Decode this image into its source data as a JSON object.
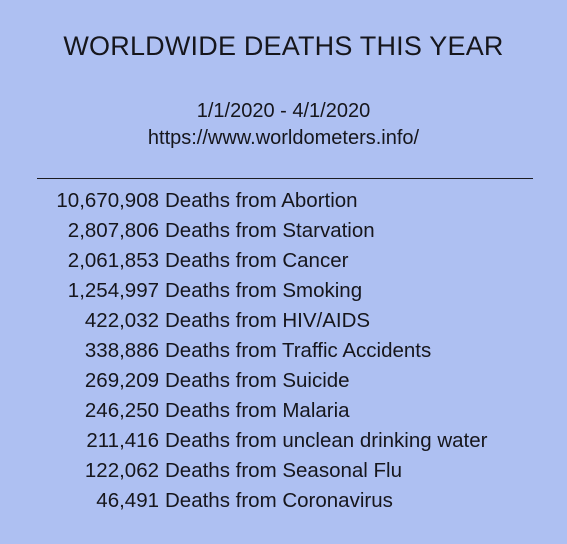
{
  "header": {
    "title": "WORLDWIDE DEATHS THIS YEAR",
    "date_range": "1/1/2020 - 4/1/2020",
    "source_url": "https://www.worldometers.info/"
  },
  "rows": [
    {
      "count": "10,670,908",
      "label": "Deaths from Abortion"
    },
    {
      "count": "2,807,806",
      "label": "Deaths from Starvation"
    },
    {
      "count": "2,061,853",
      "label": "Deaths from Cancer"
    },
    {
      "count": "1,254,997",
      "label": "Deaths from Smoking"
    },
    {
      "count": "422,032",
      "label": "Deaths from HIV/AIDS"
    },
    {
      "count": "338,886",
      "label": "Deaths from Traffic Accidents"
    },
    {
      "count": "269,209",
      "label": "Deaths from Suicide"
    },
    {
      "count": "246,250",
      "label": "Deaths from Malaria"
    },
    {
      "count": "211,416",
      "label": "Deaths from unclean drinking water"
    },
    {
      "count": "122,062",
      "label": "Deaths from Seasonal Flu"
    },
    {
      "count": "46,491",
      "label": "Deaths from Coronavirus"
    }
  ],
  "colors": {
    "background": "#aec0f2",
    "text": "#16161c"
  }
}
